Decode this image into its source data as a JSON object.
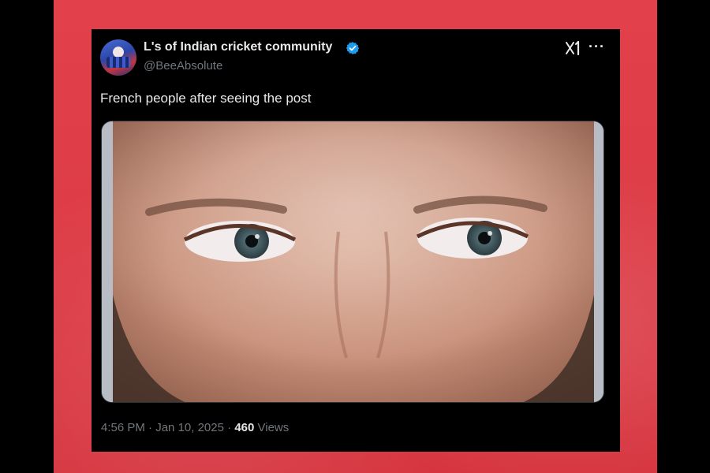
{
  "tweet": {
    "display_name": "L's of Indian cricket community",
    "handle": "@BeeAbsolute",
    "text": "French people after seeing the post",
    "time": "4:56 PM",
    "separator": "·",
    "date": "Jan 10, 2025",
    "views_count": "460",
    "views_label": "Views",
    "verified": true
  },
  "icons": {
    "verified": "verified-badge-icon",
    "grok": "grok-icon",
    "more": "more-options-icon",
    "more_glyph": "···"
  },
  "colors": {
    "backdrop_red": "#dc3c46",
    "card_bg": "#000000",
    "text_primary": "#e7e9ea",
    "text_secondary": "#71767b",
    "verified_blue": "#1d9bf0"
  }
}
